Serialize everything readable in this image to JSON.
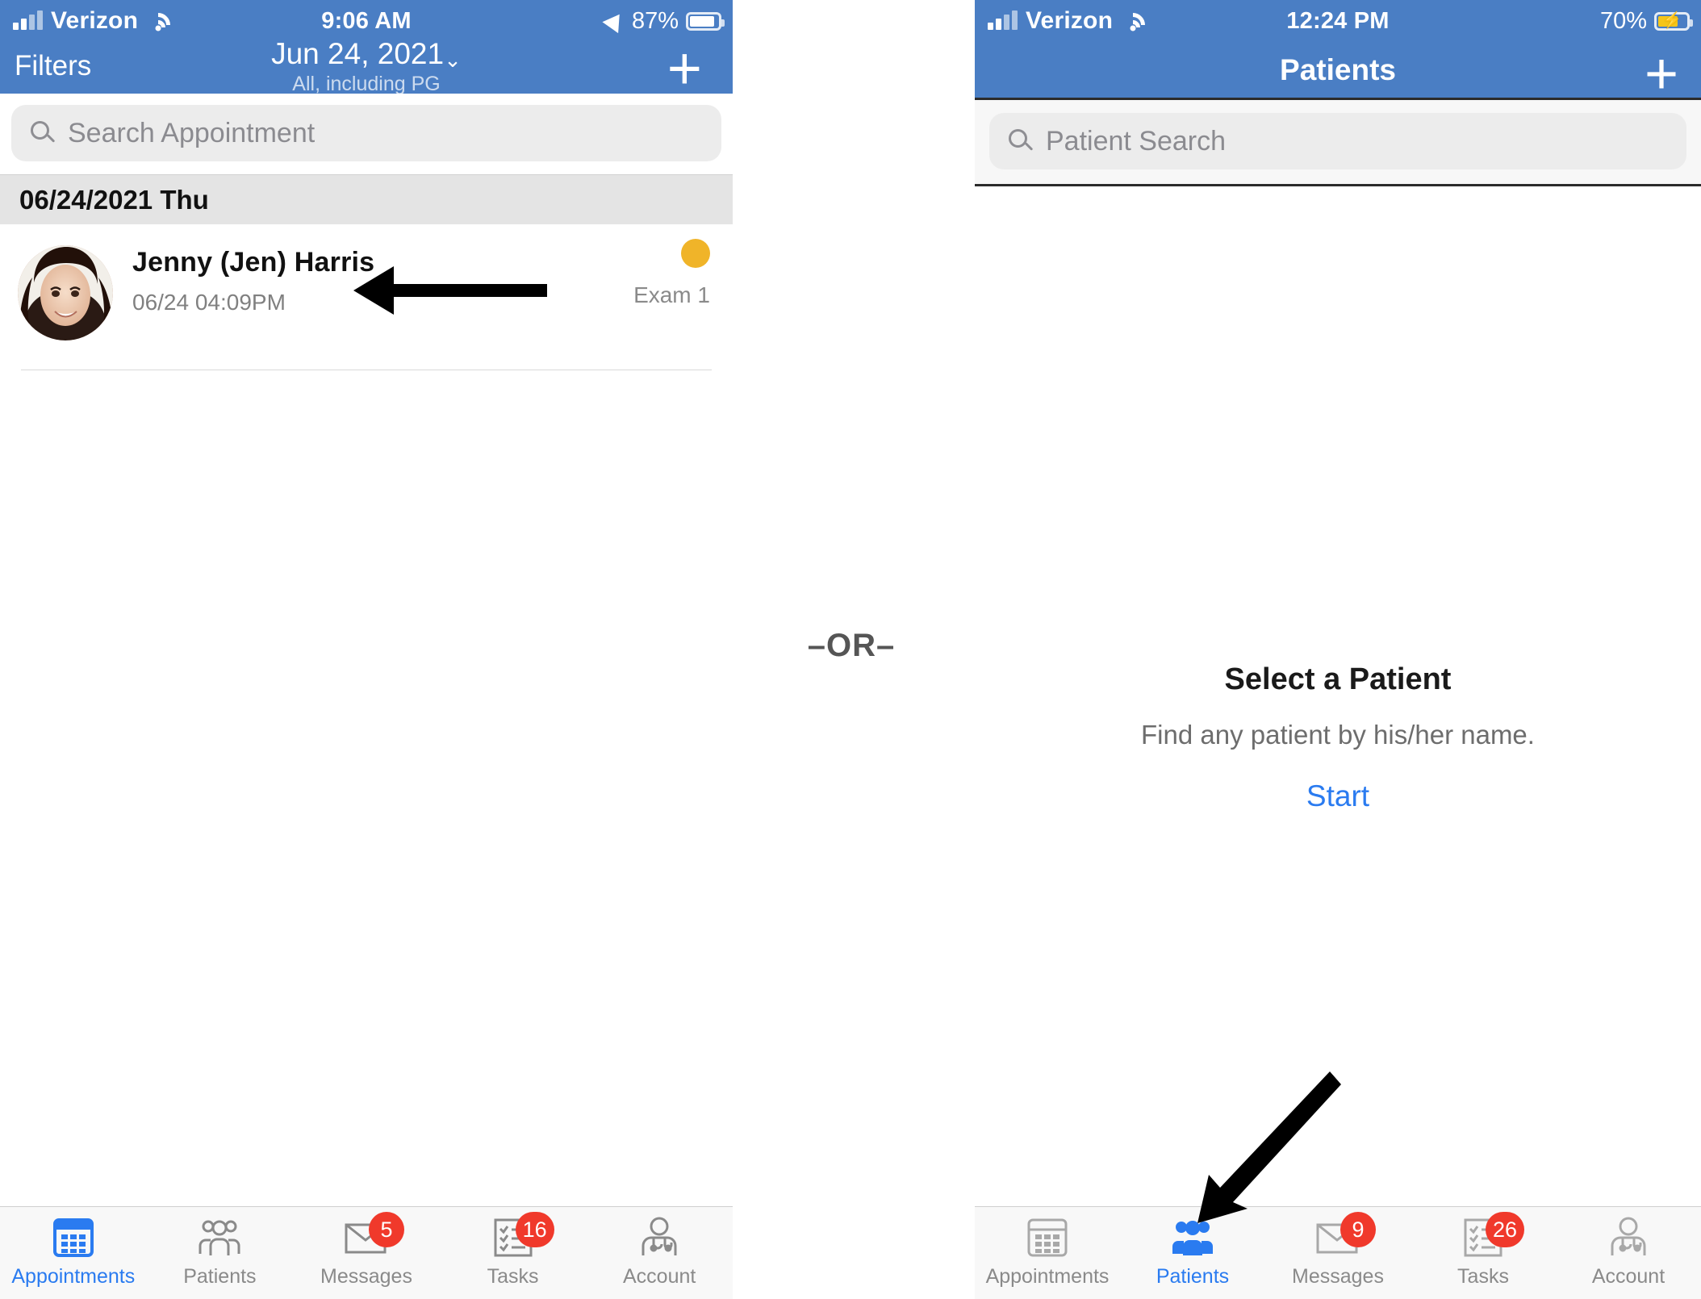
{
  "left_phone": {
    "status_bar": {
      "carrier": "Verizon",
      "time": "9:06 AM",
      "battery_percent": "87%",
      "icons": [
        "signal-bars-icon",
        "wifi-icon",
        "location-arrow-icon",
        "battery-icon"
      ]
    },
    "nav": {
      "filters_label": "Filters",
      "date_title": "Jun 24, 2021",
      "chevron": "⌄",
      "subtitle": "All, including PG",
      "add_label": "+"
    },
    "search": {
      "placeholder": "Search Appointment"
    },
    "section_header": "06/24/2021 Thu",
    "appointments": [
      {
        "patient_name": "Jenny (Jen) Harris",
        "datetime": "06/24 04:09PM",
        "room": "Exam 1",
        "status_color": "#f0b429"
      }
    ],
    "tabs": [
      {
        "label": "Appointments",
        "icon": "calendar-icon",
        "badge": "",
        "active": true
      },
      {
        "label": "Patients",
        "icon": "people-icon",
        "badge": "",
        "active": false
      },
      {
        "label": "Messages",
        "icon": "envelope-icon",
        "badge": "5",
        "active": false
      },
      {
        "label": "Tasks",
        "icon": "checklist-icon",
        "badge": "16",
        "active": false
      },
      {
        "label": "Account",
        "icon": "doctor-icon",
        "badge": "",
        "active": false
      }
    ]
  },
  "divider": {
    "or_label": "–OR–"
  },
  "right_phone": {
    "status_bar": {
      "carrier": "Verizon",
      "time": "12:24 PM",
      "battery_percent": "70%",
      "icons": [
        "signal-bars-icon",
        "wifi-icon",
        "battery-charging-icon"
      ]
    },
    "nav": {
      "title": "Patients",
      "add_label": "+"
    },
    "search": {
      "placeholder": "Patient Search"
    },
    "empty_state": {
      "title": "Select a Patient",
      "subtitle": "Find any patient by his/her name.",
      "action_label": "Start"
    },
    "tabs": [
      {
        "label": "Appointments",
        "icon": "calendar-icon",
        "badge": "",
        "active": false
      },
      {
        "label": "Patients",
        "icon": "people-icon",
        "badge": "",
        "active": true
      },
      {
        "label": "Messages",
        "icon": "envelope-icon",
        "badge": "9",
        "active": false
      },
      {
        "label": "Tasks",
        "icon": "checklist-icon",
        "badge": "26",
        "active": false
      },
      {
        "label": "Account",
        "icon": "doctor-icon",
        "badge": "",
        "active": false
      }
    ]
  },
  "colors": {
    "header_blue": "#4a7ec4",
    "accent_blue": "#2a7bf0",
    "badge_red": "#f0392b",
    "status_yellow": "#f0b429"
  }
}
